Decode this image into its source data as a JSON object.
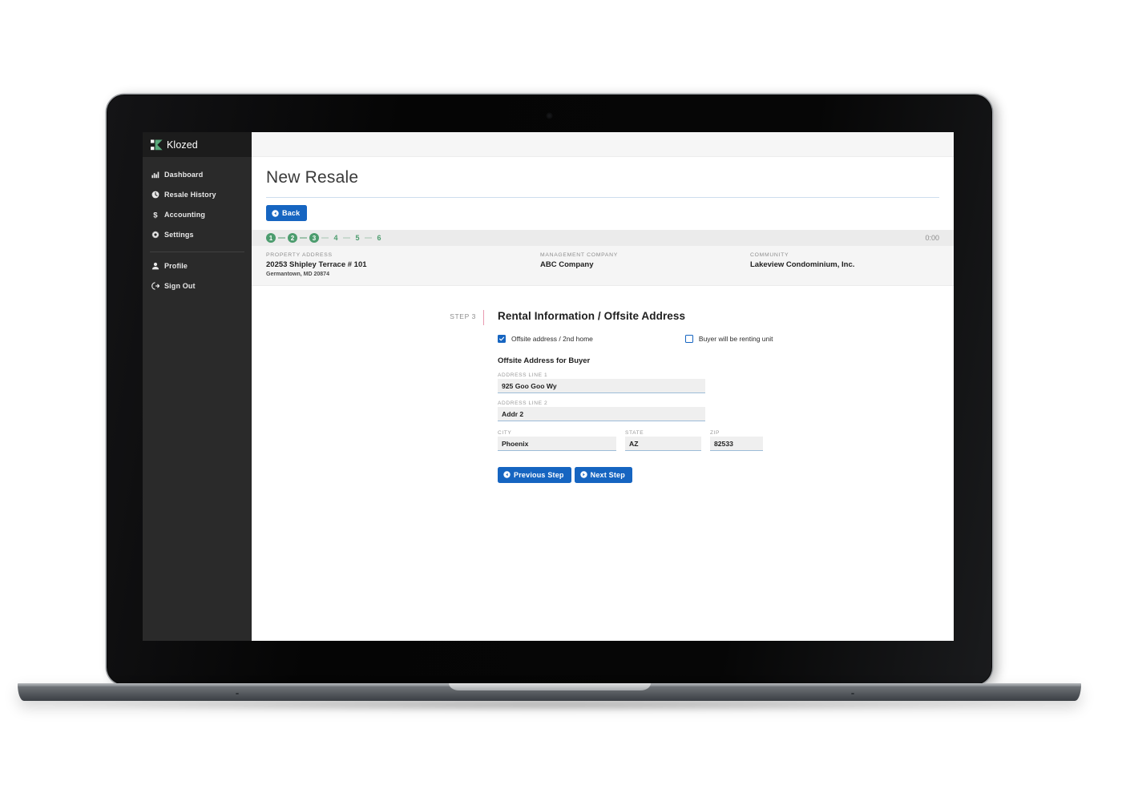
{
  "brand": {
    "name": "Klozed",
    "mark_icon": "klozed-logo-icon"
  },
  "sidebar": {
    "items": [
      {
        "label": "Dashboard",
        "icon": "bar-chart-icon"
      },
      {
        "label": "Resale History",
        "icon": "clock-icon"
      },
      {
        "label": "Accounting",
        "icon": "dollar-sign-icon"
      },
      {
        "label": "Settings",
        "icon": "gear-icon"
      }
    ],
    "footer_items": [
      {
        "label": "Profile",
        "icon": "user-icon"
      },
      {
        "label": "Sign Out",
        "icon": "sign-out-icon"
      }
    ]
  },
  "page": {
    "title": "New Resale",
    "back_label": "Back",
    "back_icon": "arrow-left-circle-icon"
  },
  "stepper": {
    "completed": [
      "1",
      "2",
      "3"
    ],
    "upcoming": [
      "4",
      "5",
      "6"
    ],
    "timer": "0:00"
  },
  "info_bar": {
    "property": {
      "label": "PROPERTY ADDRESS",
      "value": "20253 Shipley Terrace # 101",
      "sub": "Germantown, MD 20874"
    },
    "management": {
      "label": "MANAGEMENT COMPANY",
      "value": "ABC Company"
    },
    "community": {
      "label": "COMMUNITY",
      "value": "Lakeview Condominium, Inc."
    }
  },
  "form": {
    "step_tag": "STEP 3",
    "title": "Rental Information / Offsite Address",
    "checkbox_offsite": {
      "label": "Offsite address / 2nd home",
      "checked": true
    },
    "checkbox_renting": {
      "label": "Buyer will be renting unit",
      "checked": false
    },
    "section_title": "Offsite Address for Buyer",
    "fields": {
      "address1": {
        "label": "ADDRESS LINE 1",
        "value": "925 Goo Goo Wy",
        "placeholder": "Address Line 1"
      },
      "address2": {
        "label": "ADDRESS LINE 2",
        "value": "Addr 2",
        "placeholder": "Address Line 2"
      },
      "city": {
        "label": "CITY",
        "value": "Phoenix",
        "placeholder": "City"
      },
      "state": {
        "label": "STATE",
        "value": "AZ",
        "placeholder": "State"
      },
      "zip": {
        "label": "ZIP",
        "value": "82533",
        "placeholder": "Zip"
      }
    },
    "previous_label": "Previous Step",
    "previous_icon": "arrow-left-circle-icon",
    "next_label": "Next Step",
    "next_icon": "arrow-right-circle-icon"
  },
  "colors": {
    "sidebar_bg": "#2a2a2a",
    "brand_bg": "#1c1c1c",
    "accent_blue": "#1665c1",
    "step_green": "#4c9c6e",
    "logo_green": "#5aa97c",
    "field_underline": "#9dbcd8",
    "step_sep_pink": "#e89ab0"
  }
}
